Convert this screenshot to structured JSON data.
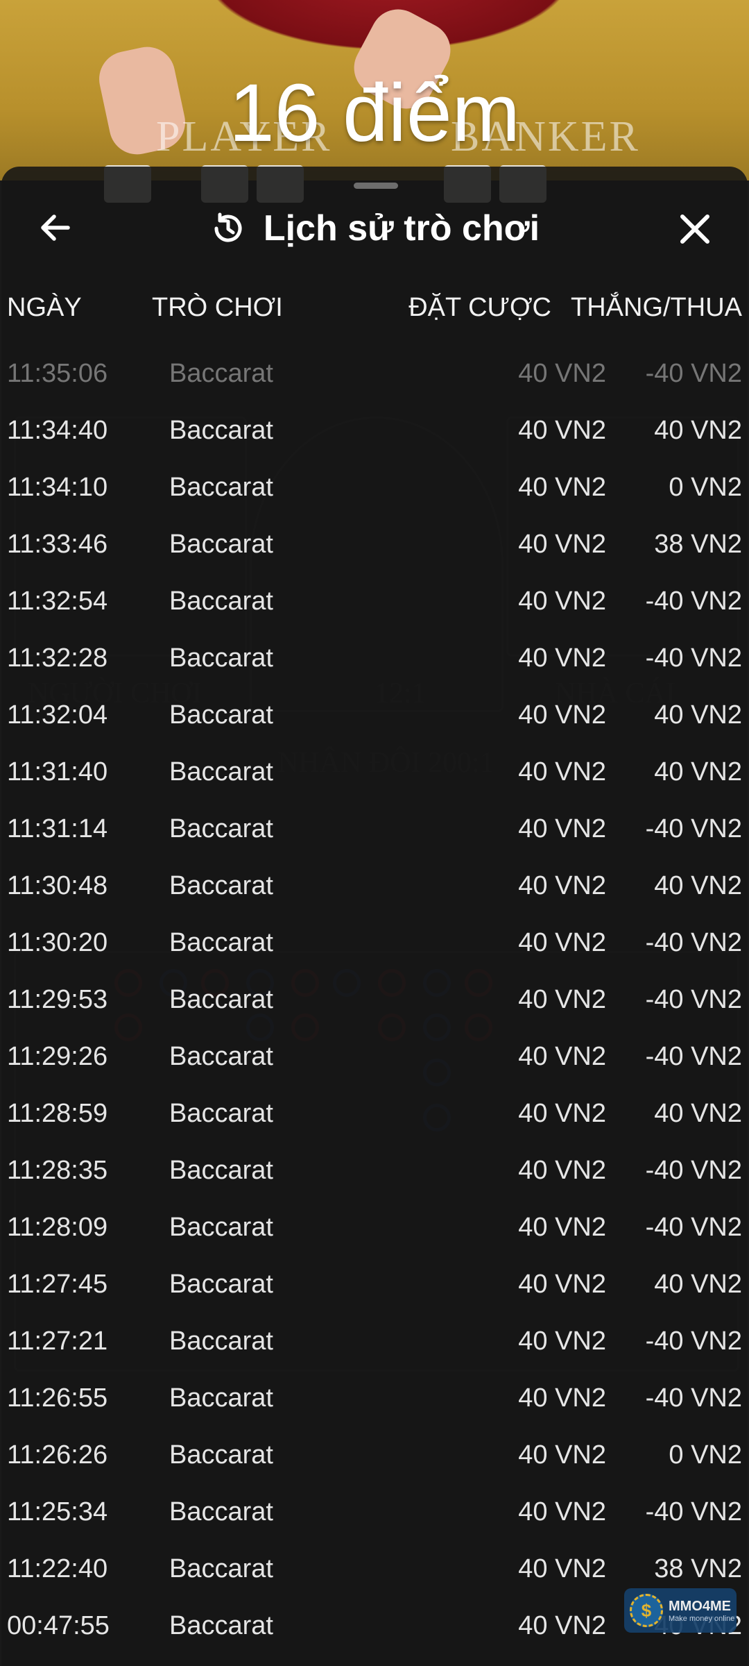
{
  "background": {
    "score_overlay": "16 điểm",
    "player_label": "PLAYER",
    "banker_label": "BANKER"
  },
  "panel": {
    "title": "Lịch sử trò chơi",
    "back_icon": "arrow-left-icon",
    "history_icon": "clock-history-icon",
    "close_icon": "close-icon"
  },
  "table": {
    "headers": {
      "date": "NGÀY",
      "game": "TRÒ CHƠI",
      "bet": "ĐẶT CƯỢC",
      "result": "THẮNG/THUA"
    },
    "rows": [
      {
        "time": "11:35:06",
        "game": "Baccarat",
        "bet": "40 VN2",
        "result": "-40 VN2"
      },
      {
        "time": "11:34:40",
        "game": "Baccarat",
        "bet": "40 VN2",
        "result": "40 VN2"
      },
      {
        "time": "11:34:10",
        "game": "Baccarat",
        "bet": "40 VN2",
        "result": "0 VN2"
      },
      {
        "time": "11:33:46",
        "game": "Baccarat",
        "bet": "40 VN2",
        "result": "38 VN2"
      },
      {
        "time": "11:32:54",
        "game": "Baccarat",
        "bet": "40 VN2",
        "result": "-40 VN2"
      },
      {
        "time": "11:32:28",
        "game": "Baccarat",
        "bet": "40 VN2",
        "result": "-40 VN2"
      },
      {
        "time": "11:32:04",
        "game": "Baccarat",
        "bet": "40 VN2",
        "result": "40 VN2"
      },
      {
        "time": "11:31:40",
        "game": "Baccarat",
        "bet": "40 VN2",
        "result": "40 VN2"
      },
      {
        "time": "11:31:14",
        "game": "Baccarat",
        "bet": "40 VN2",
        "result": "-40 VN2"
      },
      {
        "time": "11:30:48",
        "game": "Baccarat",
        "bet": "40 VN2",
        "result": "40 VN2"
      },
      {
        "time": "11:30:20",
        "game": "Baccarat",
        "bet": "40 VN2",
        "result": "-40 VN2"
      },
      {
        "time": "11:29:53",
        "game": "Baccarat",
        "bet": "40 VN2",
        "result": "-40 VN2"
      },
      {
        "time": "11:29:26",
        "game": "Baccarat",
        "bet": "40 VN2",
        "result": "-40 VN2"
      },
      {
        "time": "11:28:59",
        "game": "Baccarat",
        "bet": "40 VN2",
        "result": "40 VN2"
      },
      {
        "time": "11:28:35",
        "game": "Baccarat",
        "bet": "40 VN2",
        "result": "-40 VN2"
      },
      {
        "time": "11:28:09",
        "game": "Baccarat",
        "bet": "40 VN2",
        "result": "-40 VN2"
      },
      {
        "time": "11:27:45",
        "game": "Baccarat",
        "bet": "40 VN2",
        "result": "40 VN2"
      },
      {
        "time": "11:27:21",
        "game": "Baccarat",
        "bet": "40 VN2",
        "result": "-40 VN2"
      },
      {
        "time": "11:26:55",
        "game": "Baccarat",
        "bet": "40 VN2",
        "result": "-40 VN2"
      },
      {
        "time": "11:26:26",
        "game": "Baccarat",
        "bet": "40 VN2",
        "result": "0 VN2"
      },
      {
        "time": "11:25:34",
        "game": "Baccarat",
        "bet": "40 VN2",
        "result": "-40 VN2"
      },
      {
        "time": "11:22:40",
        "game": "Baccarat",
        "bet": "40 VN2",
        "result": "38 VN2"
      },
      {
        "time": "00:47:55",
        "game": "Baccarat",
        "bet": "40 VN2",
        "result": "40 VN2"
      }
    ]
  },
  "watermark": {
    "name": "MMO4ME",
    "tagline": "Make money online",
    "coin_symbol": "$"
  },
  "colors": {
    "sheet_bg": "#161616",
    "felt": "#c9a23a",
    "text": "#e6e6e6",
    "faded_text": "#767676"
  }
}
